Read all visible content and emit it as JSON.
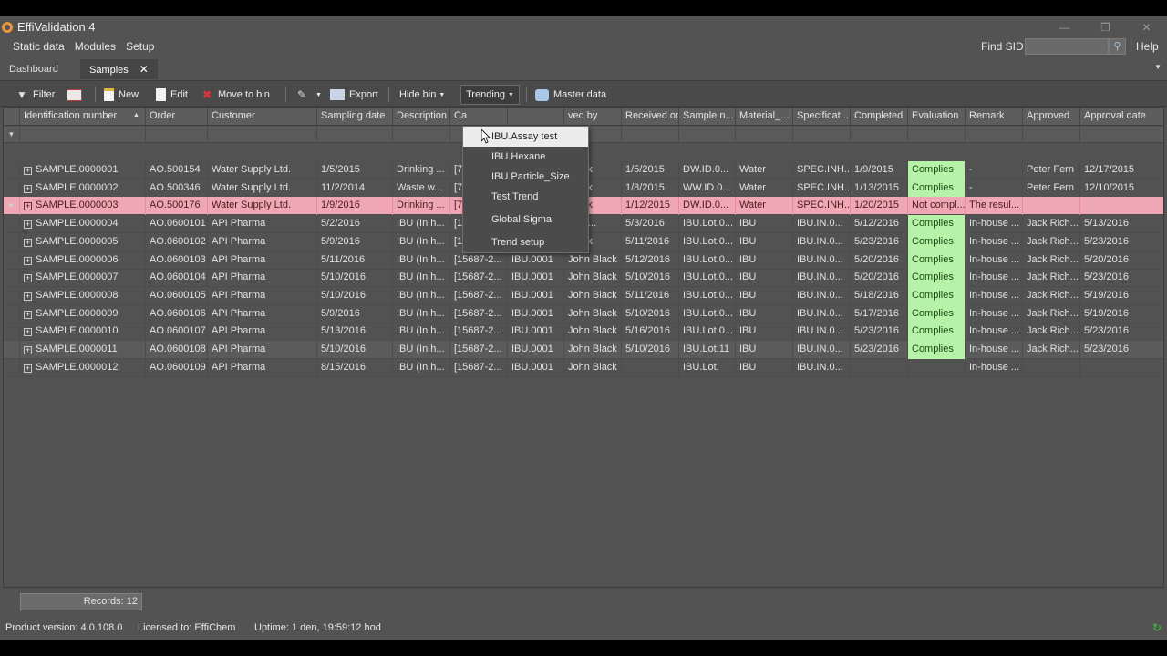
{
  "window": {
    "title": "EffiValidation 4",
    "controls": [
      "—",
      "❐",
      "✕"
    ]
  },
  "menu": {
    "items": [
      "Static data",
      "Modules",
      "Setup"
    ],
    "find_sid_label": "Find SID",
    "find_sid_value": "",
    "help": "Help"
  },
  "tabs": [
    {
      "label": "Dashboard"
    },
    {
      "label": "Samples",
      "close": "✕"
    }
  ],
  "toolbar": {
    "filter": "Filter",
    "new": "New",
    "edit": "Edit",
    "move_to_bin": "Move to bin",
    "export": "Export",
    "hide_bin": "Hide bin",
    "trending": "Trending",
    "master_data": "Master data"
  },
  "columns": [
    "Identification number",
    "Order",
    "Customer",
    "Sampling date",
    "Description",
    "Ca",
    "",
    "ved by",
    "Received on",
    "Sample n...",
    "Material_...",
    "Specificat...",
    "Completed",
    "Evaluation",
    "Remark",
    "Approved",
    "Approval date"
  ],
  "rows": [
    [
      "SAMPLE.0000001",
      "AO.500154",
      "Water Supply Ltd.",
      "1/5/2015",
      "Drinking ...",
      "[7",
      "",
      "Black",
      "1/5/2015",
      "DW.ID.0...",
      "Water",
      "SPEC.INH...",
      "1/9/2015",
      "Complies",
      "-",
      "Peter Fern",
      "12/17/2015"
    ],
    [
      "SAMPLE.0000002",
      "AO.500346",
      "Water Supply Ltd.",
      "11/2/2014",
      "Waste w...",
      "[7",
      "",
      "Black",
      "1/8/2015",
      "WW.ID.0...",
      "Water",
      "SPEC.INH...",
      "1/13/2015",
      "Complies",
      "-",
      "Peter Fern",
      "12/10/2015"
    ],
    [
      "SAMPLE.0000003",
      "AO.500176",
      "Water Supply Ltd.",
      "1/9/2016",
      "Drinking ...",
      "[7",
      "",
      "Black",
      "1/12/2015",
      "DW.ID.0...",
      "Water",
      "SPEC.INH...",
      "1/20/2015",
      "Not compl...",
      "The resul...",
      "",
      ""
    ],
    [
      "SAMPLE.0000004",
      "AO.0600101",
      "API Pharma",
      "5/2/2016",
      "IBU (In h...",
      "[1",
      "",
      "Rich...",
      "5/3/2016",
      "IBU.Lot.0...",
      "IBU",
      "IBU.IN.0...",
      "5/12/2016",
      "Complies",
      "In-house ...",
      "Jack Rich...",
      "5/13/2016"
    ],
    [
      "SAMPLE.0000005",
      "AO.0600102",
      "API Pharma",
      "5/9/2016",
      "IBU (In h...",
      "[1",
      "",
      "Black",
      "5/11/2016",
      "IBU.Lot.0...",
      "IBU",
      "IBU.IN.0...",
      "5/23/2016",
      "Complies",
      "In-house ...",
      "Jack Rich...",
      "5/23/2016"
    ],
    [
      "SAMPLE.0000006",
      "AO.0600103",
      "API Pharma",
      "5/11/2016",
      "IBU (In h...",
      "[15687-2...",
      "IBU.0001",
      "John Black",
      "5/12/2016",
      "IBU.Lot.0...",
      "IBU",
      "IBU.IN.0...",
      "5/20/2016",
      "Complies",
      "In-house ...",
      "Jack Rich...",
      "5/20/2016"
    ],
    [
      "SAMPLE.0000007",
      "AO.0600104",
      "API Pharma",
      "5/10/2016",
      "IBU (In h...",
      "[15687-2...",
      "IBU.0001",
      "John Black",
      "5/10/2016",
      "IBU.Lot.0...",
      "IBU",
      "IBU.IN.0...",
      "5/20/2016",
      "Complies",
      "In-house ...",
      "Jack Rich...",
      "5/23/2016"
    ],
    [
      "SAMPLE.0000008",
      "AO.0600105",
      "API Pharma",
      "5/10/2016",
      "IBU (In h...",
      "[15687-2...",
      "IBU.0001",
      "John Black",
      "5/11/2016",
      "IBU.Lot.0...",
      "IBU",
      "IBU.IN.0...",
      "5/18/2016",
      "Complies",
      "In-house ...",
      "Jack Rich...",
      "5/19/2016"
    ],
    [
      "SAMPLE.0000009",
      "AO.0600106",
      "API Pharma",
      "5/9/2016",
      "IBU (In h...",
      "[15687-2...",
      "IBU.0001",
      "John Black",
      "5/10/2016",
      "IBU.Lot.0...",
      "IBU",
      "IBU.IN.0...",
      "5/17/2016",
      "Complies",
      "In-house ...",
      "Jack Rich...",
      "5/19/2016"
    ],
    [
      "SAMPLE.0000010",
      "AO.0600107",
      "API Pharma",
      "5/13/2016",
      "IBU (In h...",
      "[15687-2...",
      "IBU.0001",
      "John Black",
      "5/16/2016",
      "IBU.Lot.0...",
      "IBU",
      "IBU.IN.0...",
      "5/23/2016",
      "Complies",
      "In-house ...",
      "Jack Rich...",
      "5/23/2016"
    ],
    [
      "SAMPLE.0000011",
      "AO.0600108",
      "API Pharma",
      "5/10/2016",
      "IBU (In h...",
      "[15687-2...",
      "IBU.0001",
      "John Black",
      "5/10/2016",
      "IBU.Lot.11",
      "IBU",
      "IBU.IN.0...",
      "5/23/2016",
      "Complies",
      "In-house ...",
      "Jack Rich...",
      "5/23/2016"
    ],
    [
      "SAMPLE.0000012",
      "AO.0600109",
      "API Pharma",
      "8/15/2016",
      "IBU (In h...",
      "[15687-2...",
      "IBU.0001",
      "John Black",
      "",
      "IBU.Lot.",
      "IBU",
      "IBU.IN.0...",
      "",
      "",
      "In-house ...",
      "",
      ""
    ]
  ],
  "trending_menu": [
    "IBU.Assay test",
    "IBU.Hexane",
    "IBU.Particle_Size",
    "Test Trend",
    "Global Sigma",
    "Trend setup"
  ],
  "status": {
    "records": "Records: 12"
  },
  "footer": {
    "version": "Product version: 4.0.108.0",
    "licensed": "Licensed to: EffiChem",
    "uptime": "Uptime: 1 den, 19:59:12 hod"
  },
  "colors": {
    "complies": "#b6f2a8",
    "selected_row": "#f0a7b4",
    "background": "#535353"
  },
  "icons": {
    "filter": "filter-icon",
    "layout": "grid-layout-icon",
    "new": "new-document-icon",
    "edit": "edit-document-icon",
    "bin": "delete-icon",
    "tools": "tools-icon",
    "export": "export-icon",
    "master": "database-icon",
    "search": "search-icon",
    "refresh": "refresh-icon"
  }
}
